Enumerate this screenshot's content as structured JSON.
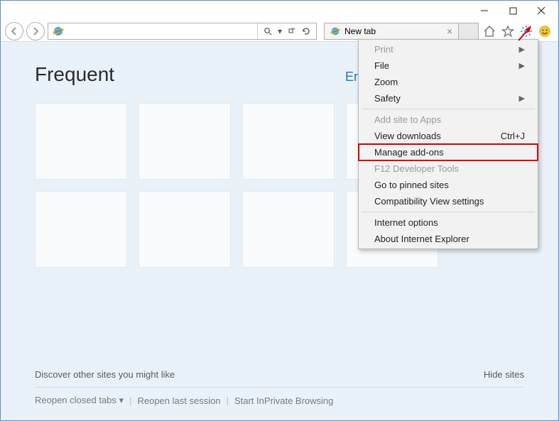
{
  "window": {
    "title": ""
  },
  "tab": {
    "title": "New tab"
  },
  "content": {
    "frequent_heading": "Frequent",
    "enable_link_partial": "Ena",
    "discover_text": "Discover other sites you might like",
    "hide_sites": "Hide sites",
    "reopen_closed": "Reopen closed tabs",
    "reopen_last": "Reopen last session",
    "inprivate": "Start InPrivate Browsing"
  },
  "menu": {
    "print": "Print",
    "file": "File",
    "zoom": "Zoom",
    "safety": "Safety",
    "add_site": "Add site to Apps",
    "view_downloads": "View downloads",
    "view_downloads_shortcut": "Ctrl+J",
    "manage_addons": "Manage add-ons",
    "f12": "F12 Developer Tools",
    "pinned": "Go to pinned sites",
    "compat": "Compatibility View settings",
    "internet_options": "Internet options",
    "about": "About Internet Explorer"
  }
}
